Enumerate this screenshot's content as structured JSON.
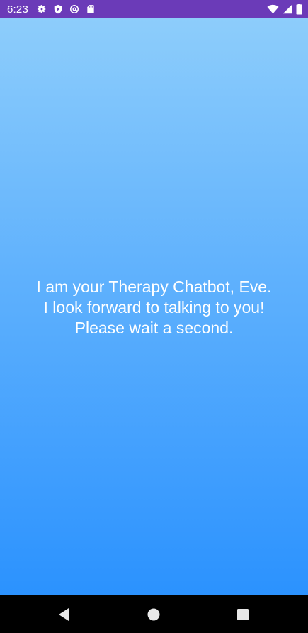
{
  "status_bar": {
    "time": "6:23",
    "left_icons": [
      "gear-icon",
      "shield-play-icon",
      "at-sign-icon",
      "sd-card-icon"
    ],
    "right_icons": [
      "wifi-icon",
      "signal-icon",
      "battery-icon"
    ],
    "background_color": "#6b3bb8"
  },
  "main": {
    "message": "I am your Therapy Chatbot, Eve. I look forward to talking to you! Please wait a second.",
    "gradient_top_color": "#8dcdfb",
    "gradient_bottom_color": "#2b92fe"
  },
  "nav_bar": {
    "buttons": [
      "back-icon",
      "home-icon",
      "recents-icon"
    ]
  }
}
